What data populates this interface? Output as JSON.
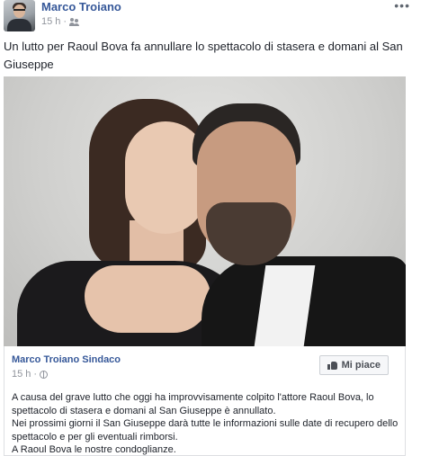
{
  "post": {
    "author": "Marco Troiano",
    "time": "15 h",
    "separator": "·",
    "audience_icon": "friends-icon",
    "more_label": "•••",
    "text": "Un lutto per Raoul Bova fa annullare lo spettacolo di stasera e domani al San Giuseppe"
  },
  "shared": {
    "author": "Marco Troiano Sindaco",
    "time": "15 h",
    "separator": "·",
    "audience_icon": "globe-icon",
    "like_button_label": "Mi piace",
    "like_icon": "thumbs-up-icon",
    "lines": [
      "A causa del grave lutto che oggi ha improvvisamente colpito l'attore Raoul Bova, lo spettacolo di stasera e domani al San Giuseppe è annullato.",
      "Nei prossimi giorni il San Giuseppe darà tutte le informazioni sulle date di recupero dello spettacolo e per gli eventuali rimborsi.",
      "A Raoul Bova le nostre condoglianze."
    ]
  },
  "colors": {
    "link": "#365899",
    "meta": "#90949c",
    "text": "#1d2129"
  }
}
